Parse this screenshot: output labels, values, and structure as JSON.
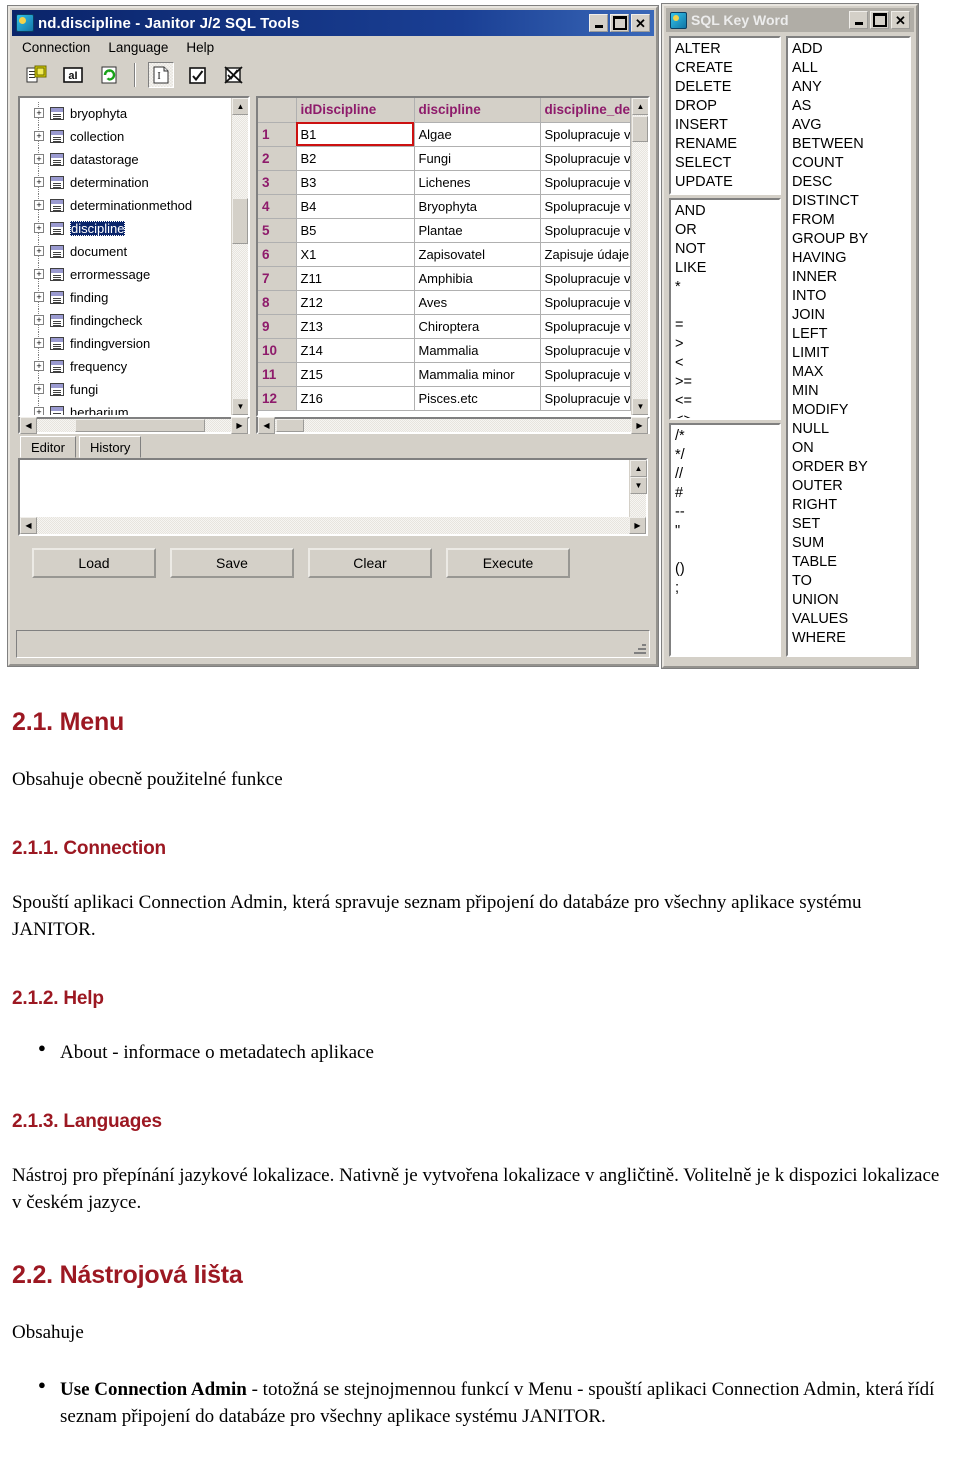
{
  "app_window": {
    "title": "nd.discipline - Janitor J/2 SQL Tools",
    "icon": "janitor-app-icon",
    "window_buttons": {
      "minimize": "_",
      "maximize": "□",
      "close": "✕"
    },
    "menubar": [
      "Connection",
      "Language",
      "Help"
    ],
    "toolbar": [
      {
        "name": "use-connection-admin-icon",
        "glyph": "☷"
      },
      {
        "name": "text-mode-icon",
        "glyph": "aI"
      },
      {
        "name": "refresh-icon",
        "glyph": "↻"
      },
      {
        "name": "insert-statement-icon",
        "glyph": "I",
        "pressed": true
      },
      {
        "name": "check-icon",
        "glyph": "✓"
      },
      {
        "name": "cancel-check-icon",
        "glyph": "✗"
      }
    ],
    "tree": {
      "items": [
        {
          "label": "bryophyta",
          "selected": false
        },
        {
          "label": "collection",
          "selected": false
        },
        {
          "label": "datastorage",
          "selected": false
        },
        {
          "label": "determination",
          "selected": false
        },
        {
          "label": "determinationmethod",
          "selected": false
        },
        {
          "label": "discipline",
          "selected": true
        },
        {
          "label": "document",
          "selected": false
        },
        {
          "label": "errormessage",
          "selected": false
        },
        {
          "label": "finding",
          "selected": false
        },
        {
          "label": "findingcheck",
          "selected": false
        },
        {
          "label": "findingversion",
          "selected": false
        },
        {
          "label": "frequency",
          "selected": false
        },
        {
          "label": "fungi",
          "selected": false
        },
        {
          "label": "herbarium",
          "selected": false
        }
      ],
      "expander": "+"
    },
    "grid": {
      "columns": [
        "idDiscipline",
        "discipline",
        "discipline_de"
      ],
      "rows": [
        {
          "n": "1",
          "cells": [
            "B1",
            "Algae",
            "Spolupracuje v"
          ]
        },
        {
          "n": "2",
          "cells": [
            "B2",
            "Fungi",
            "Spolupracuje v"
          ]
        },
        {
          "n": "3",
          "cells": [
            "B3",
            "Lichenes",
            "Spolupracuje v"
          ]
        },
        {
          "n": "4",
          "cells": [
            "B4",
            "Bryophyta",
            "Spolupracuje v"
          ]
        },
        {
          "n": "5",
          "cells": [
            "B5",
            "Plantae",
            "Spolupracuje v"
          ]
        },
        {
          "n": "6",
          "cells": [
            "X1",
            "Zapisovatel",
            "Zapisuje údaje"
          ]
        },
        {
          "n": "7",
          "cells": [
            "Z11",
            "Amphibia",
            "Spolupracuje v"
          ]
        },
        {
          "n": "8",
          "cells": [
            "Z12",
            "Aves",
            "Spolupracuje v"
          ]
        },
        {
          "n": "9",
          "cells": [
            "Z13",
            "Chiroptera",
            "Spolupracuje v"
          ]
        },
        {
          "n": "10",
          "cells": [
            "Z14",
            "Mammalia",
            "Spolupracuje v"
          ]
        },
        {
          "n": "11",
          "cells": [
            "Z15",
            "Mammalia minor",
            "Spolupracuje v"
          ]
        },
        {
          "n": "12",
          "cells": [
            "Z16",
            "Pisces.etc",
            "Spolupracuje v"
          ]
        }
      ],
      "selected_cell": {
        "row": 1,
        "column": "idDiscipline",
        "value": "B1"
      },
      "header_color": "#8e1b6b",
      "selection_border_color": "#cc1111"
    },
    "tabs": [
      {
        "label": "Editor",
        "active": true
      },
      {
        "label": "History",
        "active": false
      }
    ],
    "editor": {
      "value": ""
    },
    "buttons": [
      "Load",
      "Save",
      "Clear",
      "Execute"
    ]
  },
  "keyword_window": {
    "title": "SQL Key Word",
    "icon": "sql-keyword-icon",
    "window_buttons": {
      "minimize": "_",
      "maximize": "□",
      "close": "✕"
    },
    "statements": [
      "ALTER",
      "CREATE",
      "DELETE",
      "DROP",
      "INSERT",
      "RENAME",
      "SELECT",
      "UPDATE"
    ],
    "operators": [
      "AND",
      "OR",
      "NOT",
      "LIKE",
      "*",
      "",
      "=",
      ">",
      "<",
      ">=",
      "<=",
      "<>"
    ],
    "symbols": [
      "/*",
      "*/",
      "//",
      "#",
      "--",
      "\"",
      "",
      "()",
      ";"
    ],
    "keywords": [
      "ADD",
      "ALL",
      "ANY",
      "AS",
      "AVG",
      "BETWEEN",
      "COUNT",
      "DESC",
      "DISTINCT",
      "FROM",
      "GROUP BY",
      "HAVING",
      "INNER",
      "INTO",
      "JOIN",
      "LEFT",
      "LIMIT",
      "MAX",
      "MIN",
      "MODIFY",
      "NULL",
      "ON",
      "ORDER BY",
      "OUTER",
      "RIGHT",
      "SET",
      "SUM",
      "TABLE",
      "TO",
      "UNION",
      "VALUES",
      "WHERE"
    ]
  },
  "document": {
    "heading_color": "#9c1822",
    "s1": {
      "number_title": "2.1. Menu",
      "body": "Obsahuje obecně použitelné funkce"
    },
    "s2": {
      "number_title": "2.1.1. Connection",
      "body": "Spouští aplikaci Connection Admin, která spravuje seznam připojení do databáze pro všechny aplikace systému JANITOR."
    },
    "s3": {
      "number_title": "2.1.2. Help",
      "bullet1": "About - informace o metadatech aplikace"
    },
    "s4": {
      "number_title": "2.1.3. Languages",
      "body": "Nástroj pro přepínání jazykové lokalizace. Nativně je vytvořena lokalizace v angličtině. Volitelně je k dispozici lokalizace v českém jazyce."
    },
    "s5": {
      "number_title": "2.2. Nástrojová lišta",
      "body": "Obsahuje",
      "bullet1_bold": "Use Connection Admin",
      "bullet1_rest": " - totožná se stejnojmennou funkcí v Menu - spouští aplikaci Connection Admin, která řídí seznam připojení do databáze pro všechny aplikace systému JANITOR."
    }
  }
}
